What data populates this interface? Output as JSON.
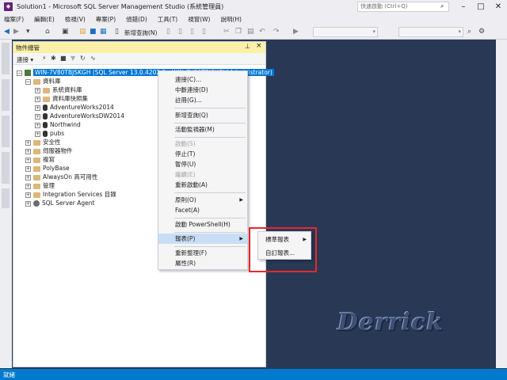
{
  "title": {
    "app_icon": "ssms-icon",
    "text": "Solution1 - Microsoft SQL Server Management Studio (系統管理員)",
    "quick_launch_placeholder": "快速啟動 (Ctrl+Q)"
  },
  "menu": [
    "檔案(F)",
    "編輯(E)",
    "檢視(V)",
    "專案(P)",
    "偵錯(D)",
    "工具(T)",
    "視窗(W)",
    "說明(H)"
  ],
  "toolbar": {
    "new_query_label": "新增查詢(N)"
  },
  "object_explorer": {
    "title": "物件總管",
    "connect_label": "連接 ▾",
    "server": "WIN-7V80TBJSKGH (SQL Server 13.0.4202.2 - WIN-7V80TBJSKGH\\Administrator)",
    "tree": {
      "databases": "資料庫",
      "system_databases": "系統資料庫",
      "db_snapshots": "資料庫快照集",
      "db1": "AdventureWorks2014",
      "db2": "AdventureWorksDW2014",
      "db3": "Northwind",
      "db4": "pubs",
      "security": "安全性",
      "server_objects": "伺服器物件",
      "replication": "複寫",
      "polybase": "PolyBase",
      "alwayson": "AlwaysOn 高可用性",
      "management": "管理",
      "integration_services": "Integration Services 目錄",
      "agent": "SQL Server Agent"
    }
  },
  "context_menu": {
    "connect": "連接(C)...",
    "disconnect": "中斷連接(D)",
    "register": "註冊(G)...",
    "new_query": "新增查詢(Q)",
    "activity_monitor": "活動監視器(M)",
    "start": "啟動(S)",
    "stop": "停止(T)",
    "pause": "暫停(U)",
    "resume": "繼續(E)",
    "restart": "重新啟動(A)",
    "policies": "原則(O)",
    "facets": "Facet(A)",
    "powershell": "啟動 PowerShell(H)",
    "reports": "報表(P)",
    "refresh": "重新整理(F)",
    "properties": "屬性(R)"
  },
  "submenu": {
    "standard_reports": "標準報表",
    "custom_reports": "自訂報表..."
  },
  "watermark": "Derrick",
  "status": "就緒",
  "colors": {
    "accent": "#007acc",
    "background": "#293955",
    "highlight": "#c9def5",
    "selection": "#0078d7",
    "callout": "#e8262b"
  }
}
